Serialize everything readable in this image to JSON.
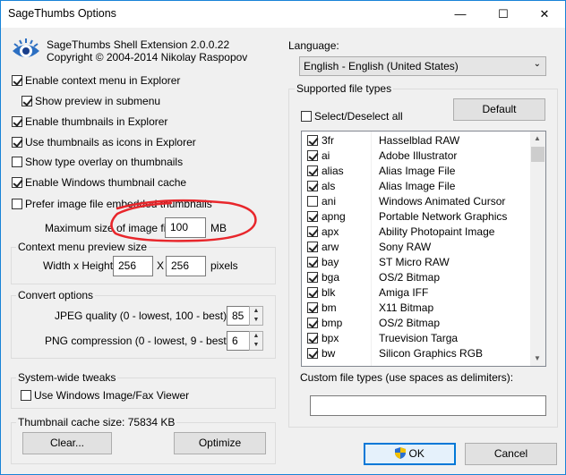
{
  "window": {
    "title": "SageThumbs Options",
    "minimize": "—",
    "maximize": "☐",
    "close": "✕"
  },
  "header": {
    "product": "SageThumbs Shell Extension 2.0.0.22",
    "copyright": "Copyright © 2004-2014 Nikolay Raspopov"
  },
  "options": {
    "enable_context_menu": {
      "label": "Enable context menu in Explorer",
      "checked": true
    },
    "show_preview_submenu": {
      "label": "Show preview in submenu",
      "checked": true
    },
    "enable_thumbnails": {
      "label": "Enable thumbnails in Explorer",
      "checked": true
    },
    "use_as_icons": {
      "label": "Use thumbnails as icons in Explorer",
      "checked": true
    },
    "show_type_overlay": {
      "label": "Show type overlay on thumbnails",
      "checked": false
    },
    "enable_windows_cache": {
      "label": "Enable Windows thumbnail cache",
      "checked": true
    },
    "prefer_embedded": {
      "label": "Prefer image file embedded thumbnails",
      "checked": false
    }
  },
  "max_size": {
    "label": "Maximum size of image file:",
    "value": "100",
    "unit": "MB"
  },
  "preview_size": {
    "group_label": "Context menu preview size",
    "label": "Width x Height:",
    "width": "256",
    "sep": "X",
    "height": "256",
    "unit": "pixels"
  },
  "convert": {
    "group_label": "Convert options",
    "jpeg_label": "JPEG quality (0 - lowest, 100 - best):",
    "jpeg_value": "85",
    "png_label": "PNG compression (0 - lowest, 9 - best):",
    "png_value": "6"
  },
  "tweaks": {
    "group_label": "System-wide tweaks",
    "fax_viewer": {
      "label": "Use Windows Image/Fax Viewer",
      "checked": false
    }
  },
  "cache": {
    "group_label": "Thumbnail cache size: 75834 KB",
    "clear_label": "Clear...",
    "optimize_label": "Optimize"
  },
  "language": {
    "label": "Language:",
    "selected": "English - English (United States)"
  },
  "filetypes": {
    "group_label": "Supported file types",
    "select_all_label": "Select/Deselect all",
    "default_label": "Default",
    "items": [
      {
        "ext": "3fr",
        "desc": "Hasselblad RAW",
        "checked": true
      },
      {
        "ext": "ai",
        "desc": "Adobe Illustrator",
        "checked": true
      },
      {
        "ext": "alias",
        "desc": "Alias Image File",
        "checked": true
      },
      {
        "ext": "als",
        "desc": "Alias Image File",
        "checked": true
      },
      {
        "ext": "ani",
        "desc": "Windows Animated Cursor",
        "checked": false
      },
      {
        "ext": "apng",
        "desc": "Portable Network Graphics",
        "checked": true
      },
      {
        "ext": "apx",
        "desc": "Ability Photopaint Image",
        "checked": true
      },
      {
        "ext": "arw",
        "desc": "Sony RAW",
        "checked": true
      },
      {
        "ext": "bay",
        "desc": "ST Micro RAW",
        "checked": true
      },
      {
        "ext": "bga",
        "desc": "OS/2 Bitmap",
        "checked": true
      },
      {
        "ext": "blk",
        "desc": "Amiga IFF",
        "checked": true
      },
      {
        "ext": "bm",
        "desc": "X11 Bitmap",
        "checked": true
      },
      {
        "ext": "bmp",
        "desc": "OS/2 Bitmap",
        "checked": true
      },
      {
        "ext": "bpx",
        "desc": "Truevision Targa",
        "checked": true
      },
      {
        "ext": "bw",
        "desc": "Silicon Graphics RGB",
        "checked": true
      }
    ],
    "custom_label": "Custom file types (use spaces as delimiters):",
    "custom_value": ""
  },
  "footer": {
    "ok_label": "OK",
    "cancel_label": "Cancel"
  },
  "colors": {
    "accent": "#1883d7",
    "annotation": "#e8262b"
  }
}
